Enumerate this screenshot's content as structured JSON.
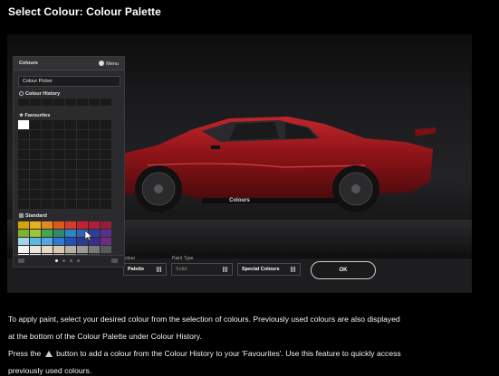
{
  "title": "Select Colour: Colour Palette",
  "panel": {
    "header": "Colours",
    "menu_label": "Menu",
    "colour_picker": "Colour Picker",
    "colour_history": "Colour History",
    "favourites": "Favourites",
    "standard": "Standard",
    "standard_colors": [
      "#d4a60a",
      "#e8b01e",
      "#e38a1f",
      "#e0571d",
      "#d63c2a",
      "#c72033",
      "#b01e3c",
      "#8f1f3c",
      "#7db32c",
      "#a3c437",
      "#46a84a",
      "#2f8b6f",
      "#2a86c4",
      "#3164b8",
      "#2d3f9c",
      "#5a2f8a",
      "#9fd3e8",
      "#5bb9e0",
      "#58a6df",
      "#2d7ad1",
      "#1f53b6",
      "#2a3b91",
      "#3b2c8c",
      "#6b2c7f",
      "#f3f3f3",
      "#ebe6dc",
      "#e8dcc9",
      "#d8c9b3",
      "#b8b1a7",
      "#9b9b9b",
      "#7a7a7a",
      "#5a5a5a",
      "#ffffff",
      "#e6e6e6",
      "#cfcfcf",
      "#b3b3b3",
      "#8e8e8e",
      "#6b6b6b",
      "#484848",
      "#2b2b2b"
    ]
  },
  "colours_label": "Colours",
  "controls": {
    "colour_label": "olour",
    "colour_value": "Palette",
    "paint_type_label": "Paint Type",
    "paint_type_value": "Solid",
    "special_colours": "Special Colours",
    "ok": "OK"
  },
  "description": {
    "line1": "To apply paint, select your desired colour from the selection of colours. Previously used colours are also displayed",
    "line2": "at the bottom of the Colour Palette under Colour History.",
    "line3_before": "Press the",
    "line3_after": "button to add a colour from the Colour History to your 'Favourites'. Use this feature to quickly access",
    "line4": "previously used colours."
  },
  "colors": {
    "car_body": "#8e1418",
    "background": "#000000",
    "panel": "#2b2b2d"
  }
}
